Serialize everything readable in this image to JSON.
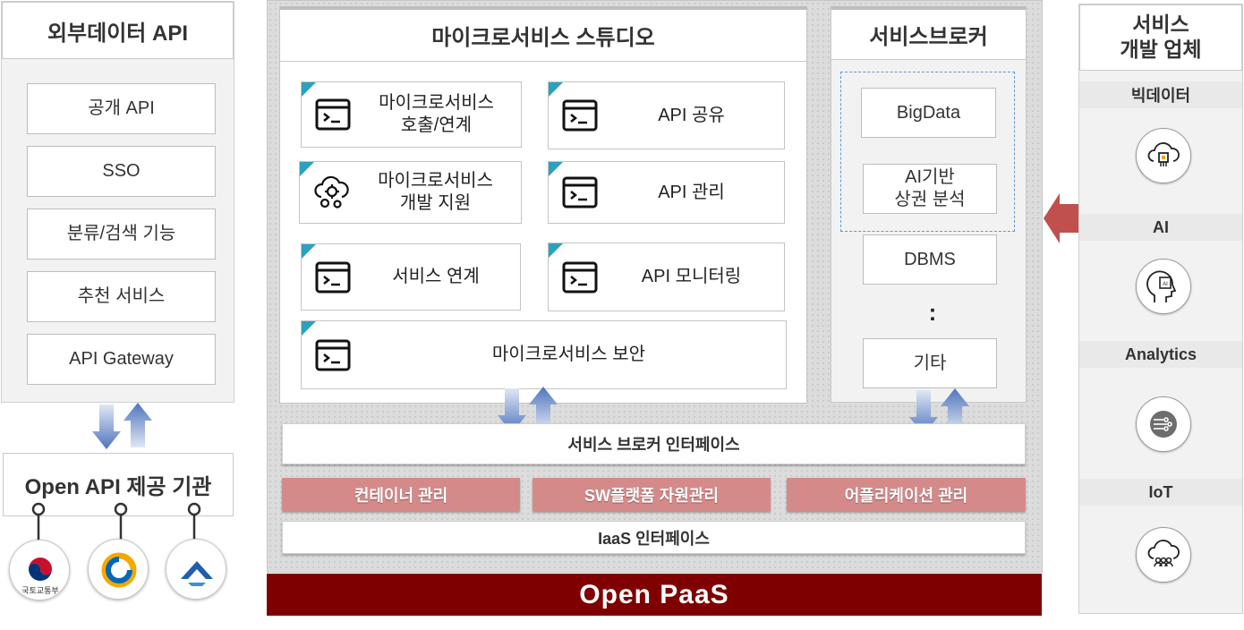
{
  "left": {
    "title": "외부데이터 API",
    "items": [
      "공개 API",
      "SSO",
      "분류/검색 기능",
      "추천 서비스",
      "API Gateway"
    ],
    "provider_title": "Open API 제공 기관",
    "provider_logo_label": "국토교통부"
  },
  "studio": {
    "title": "마이크로서비스 스튜디오",
    "cards": [
      {
        "label": "마이크로서비스\n호출/연계",
        "icon": "terminal-icon"
      },
      {
        "label": "API 공유",
        "icon": "terminal-icon"
      },
      {
        "label": "마이크로서비스\n개발 지원",
        "icon": "cloud-gears-icon"
      },
      {
        "label": "API 관리",
        "icon": "terminal-icon"
      },
      {
        "label": "서비스 연계",
        "icon": "terminal-icon"
      },
      {
        "label": "API 모니터링",
        "icon": "terminal-icon"
      },
      {
        "label": "마이크로서비스 보안",
        "icon": "terminal-icon"
      }
    ]
  },
  "broker": {
    "title": "서비스브로커",
    "items": [
      "BigData",
      "AI기반\n상권 분석",
      "DBMS",
      "기타"
    ],
    "ellipsis": ":"
  },
  "bars": {
    "broker_interface": "서비스 브로커 인터페이스",
    "container": "컨테이너 관리",
    "sw_platform": "SW플랫폼 자원관리",
    "app": "어플리케이션 관리",
    "iaas": "IaaS 인터페이스",
    "paas": "Open PaaS"
  },
  "right": {
    "title": "서비스\n개발 업체",
    "categories": [
      {
        "label": "빅데이터",
        "icon": "cloud-chip-icon"
      },
      {
        "label": "AI",
        "icon": "ai-head-icon"
      },
      {
        "label": "Analytics",
        "icon": "analytics-icon"
      },
      {
        "label": "IoT",
        "icon": "iot-cloud-icon"
      }
    ]
  },
  "colors": {
    "paas_bg": "#7f0000",
    "pink_bar": "#d58a8a",
    "arrow_blue": "#5b7cc0",
    "arrow_red": "#c0504d",
    "card_corner": "#2aa2bd"
  }
}
